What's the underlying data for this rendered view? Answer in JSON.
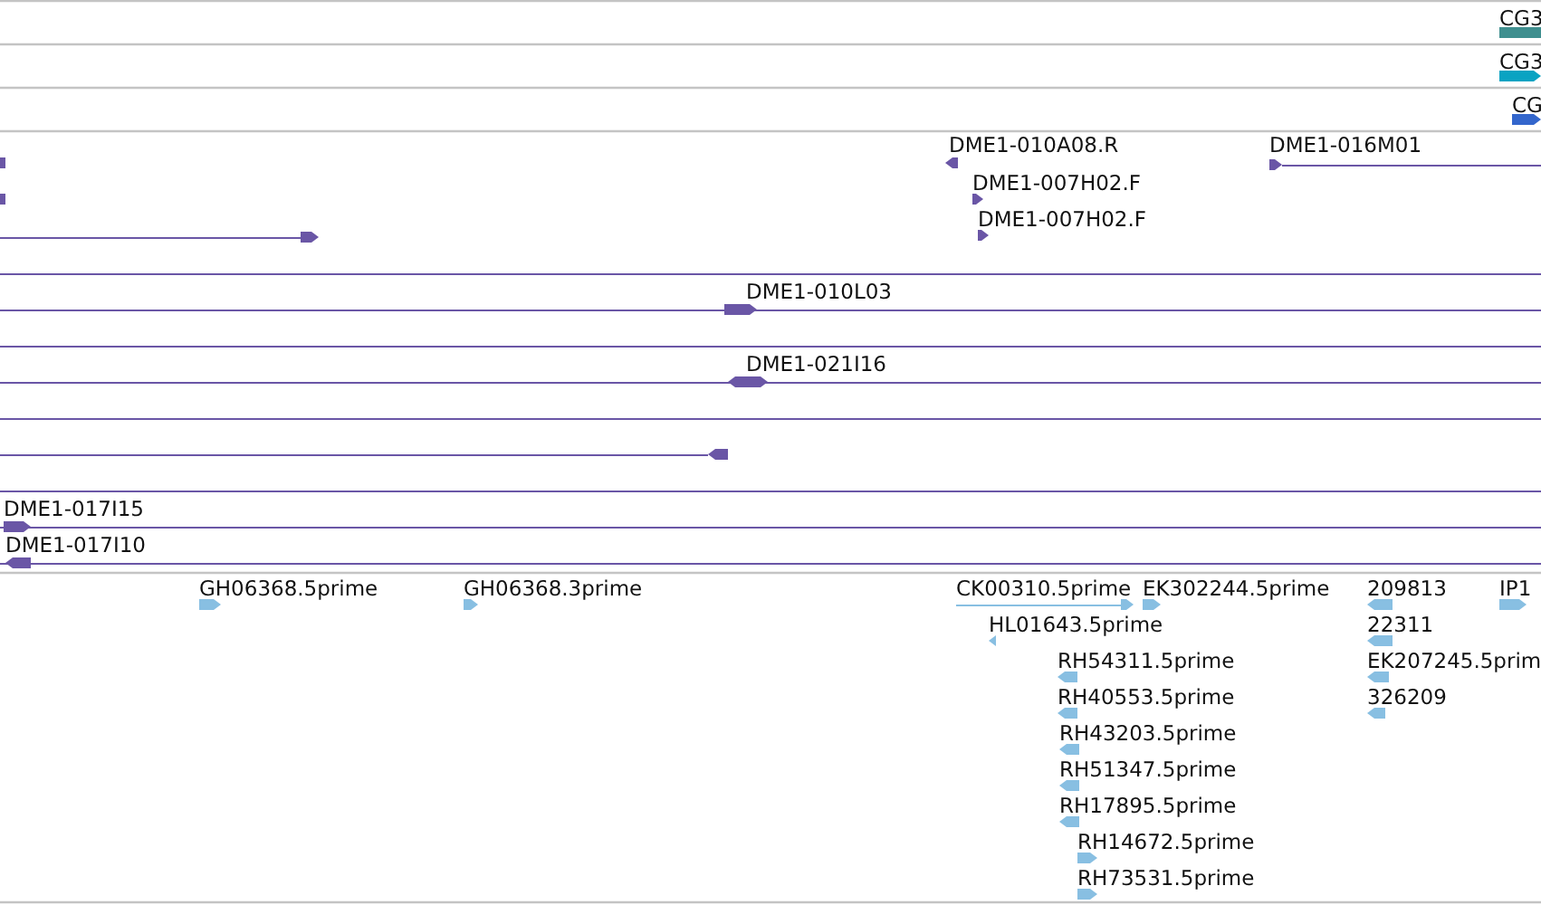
{
  "tracks": [
    {
      "kind": "gene",
      "features": [
        {
          "kind": "block",
          "label": "CG3"
        }
      ]
    },
    {
      "kind": "transcript",
      "features": [
        {
          "kind": "forward",
          "label": "CG3"
        }
      ]
    },
    {
      "kind": "cds",
      "features": [
        {
          "kind": "forward",
          "label": "CG"
        }
      ]
    },
    {
      "kind": "bac",
      "features": [
        {
          "kind": "block"
        },
        {
          "kind": "block"
        },
        {
          "kind": "forward"
        },
        {
          "kind": "reverse",
          "label": "DME1-010A08.R"
        },
        {
          "kind": "forward",
          "label": "DME1-016M01"
        },
        {
          "kind": "forward",
          "label": "DME1-007H02.F"
        },
        {
          "kind": "forward",
          "label": "DME1-007H02.F"
        },
        {
          "kind": "span"
        },
        {
          "kind": "forward",
          "label": "DME1-010L03"
        },
        {
          "kind": "span"
        },
        {
          "kind": "bidirectional",
          "label": "DME1-021I16"
        },
        {
          "kind": "span"
        },
        {
          "kind": "reverse"
        },
        {
          "kind": "span"
        },
        {
          "kind": "forward",
          "label": "DME1-017I15"
        },
        {
          "kind": "reverse",
          "label": "DME1-017I10"
        }
      ]
    },
    {
      "kind": "est",
      "features": [
        {
          "kind": "forward",
          "label": "GH06368.5prime"
        },
        {
          "kind": "forward",
          "label": "GH06368.3prime"
        },
        {
          "kind": "forward",
          "label": "CK00310.5prime"
        },
        {
          "kind": "forward",
          "label": "EK302244.5prime"
        },
        {
          "kind": "reverse",
          "label": "209813"
        },
        {
          "kind": "forward",
          "label": "IP1"
        },
        {
          "kind": "reverse",
          "label": "HL01643.5prime"
        },
        {
          "kind": "reverse",
          "label": "22311"
        },
        {
          "kind": "reverse",
          "label": "RH54311.5prime"
        },
        {
          "kind": "reverse",
          "label": "EK207245.5prim"
        },
        {
          "kind": "reverse",
          "label": "RH40553.5prime"
        },
        {
          "kind": "reverse",
          "label": "326209"
        },
        {
          "kind": "reverse",
          "label": "RH43203.5prime"
        },
        {
          "kind": "reverse",
          "label": "RH51347.5prime"
        },
        {
          "kind": "reverse",
          "label": "RH17895.5prime"
        },
        {
          "kind": "forward",
          "label": "RH14672.5prime"
        },
        {
          "kind": "forward",
          "label": "RH73531.5prime"
        }
      ]
    }
  ]
}
